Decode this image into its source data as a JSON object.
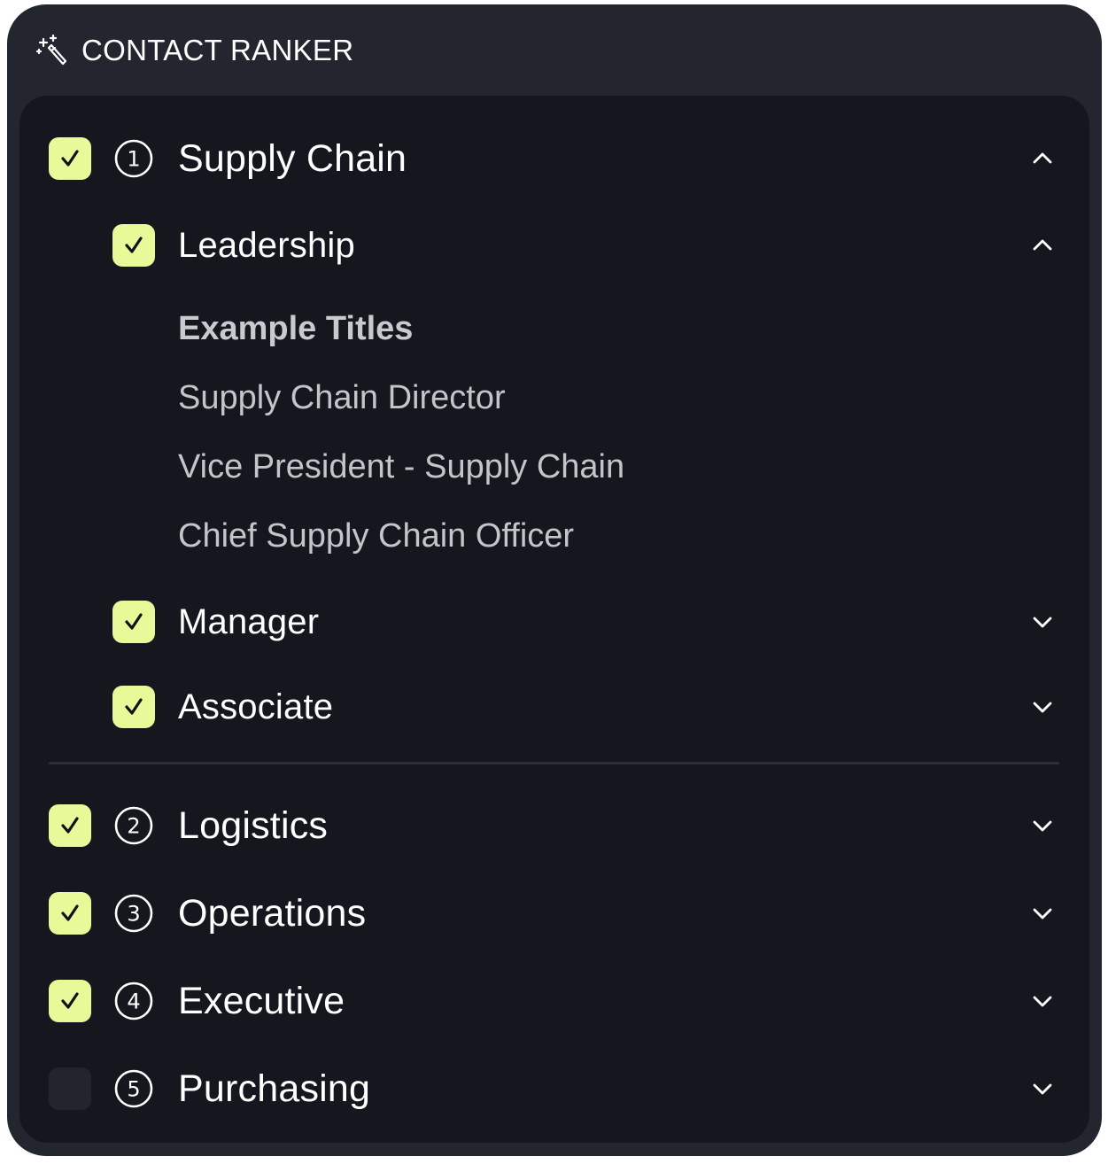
{
  "app": {
    "title": "CONTACT RANKER",
    "title_icon": "magic-wand-icon"
  },
  "colors": {
    "card_bg": "#23262f",
    "panel_bg": "#14171e",
    "checkbox_on": "#e7fa9a",
    "checkbox_off": "#22252c",
    "text_primary": "#ffffff",
    "text_secondary": "#c3c5c9"
  },
  "departments": [
    {
      "rank": "1",
      "label": "Supply Chain",
      "checked": true,
      "expanded": true,
      "levels": [
        {
          "label": "Leadership",
          "checked": true,
          "expanded": true,
          "example_titles_heading": "Example Titles",
          "example_titles": [
            "Supply Chain Director",
            "Vice President - Supply Chain",
            "Chief Supply Chain Officer"
          ]
        },
        {
          "label": "Manager",
          "checked": true,
          "expanded": false
        },
        {
          "label": "Associate",
          "checked": true,
          "expanded": false
        }
      ]
    },
    {
      "rank": "2",
      "label": "Logistics",
      "checked": true,
      "expanded": false
    },
    {
      "rank": "3",
      "label": "Operations",
      "checked": true,
      "expanded": false
    },
    {
      "rank": "4",
      "label": "Executive",
      "checked": true,
      "expanded": false
    },
    {
      "rank": "5",
      "label": "Purchasing",
      "checked": false,
      "expanded": false
    }
  ]
}
